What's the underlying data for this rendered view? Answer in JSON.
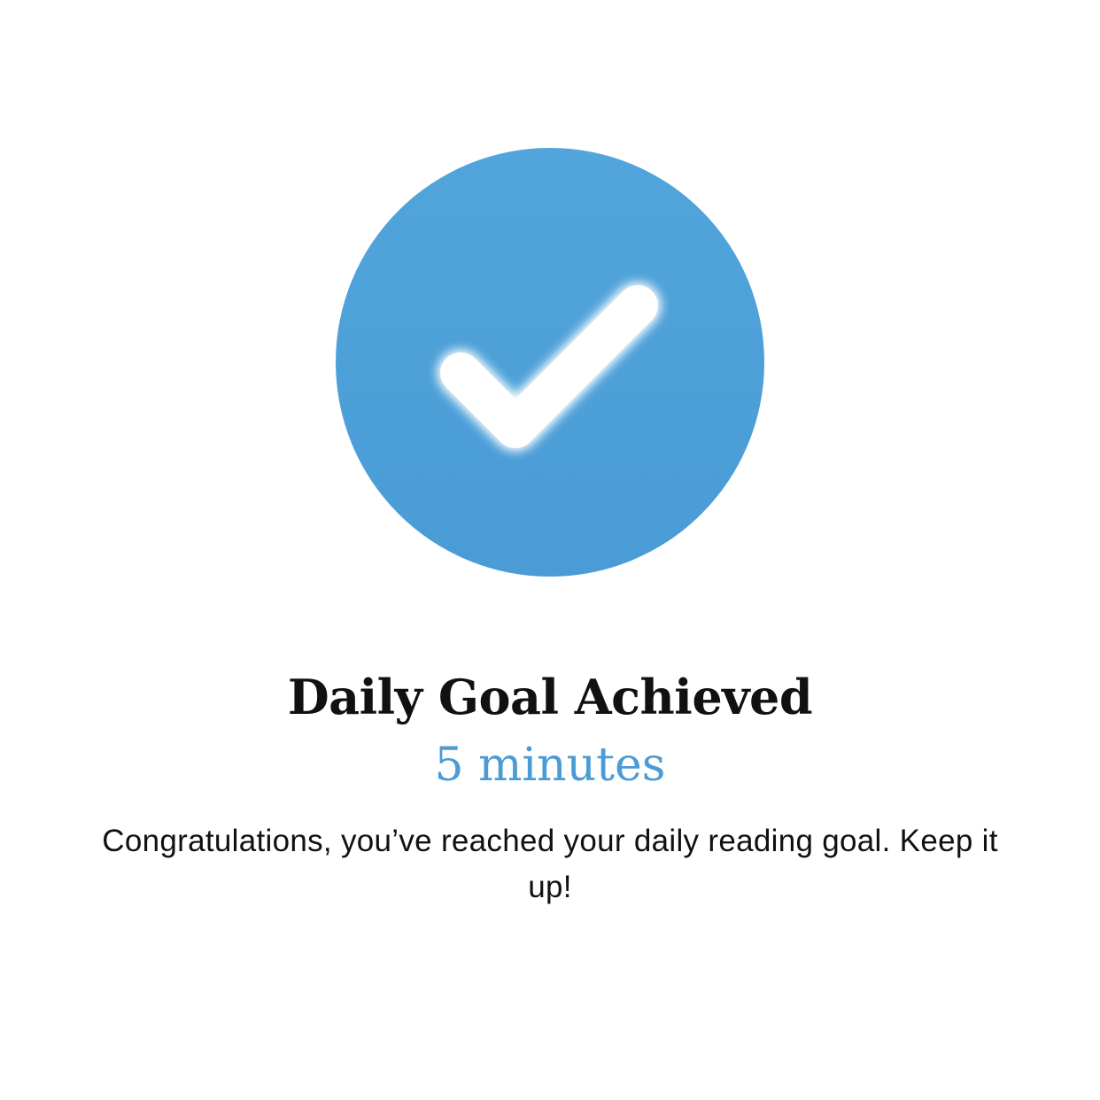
{
  "badge": {
    "icon": "checkmark-icon",
    "color": "#4a9bd6"
  },
  "title": "Daily Goal Achieved",
  "goal_value": "5 minutes",
  "message": "Congratulations, you’ve reached your daily reading goal. Keep it up!"
}
